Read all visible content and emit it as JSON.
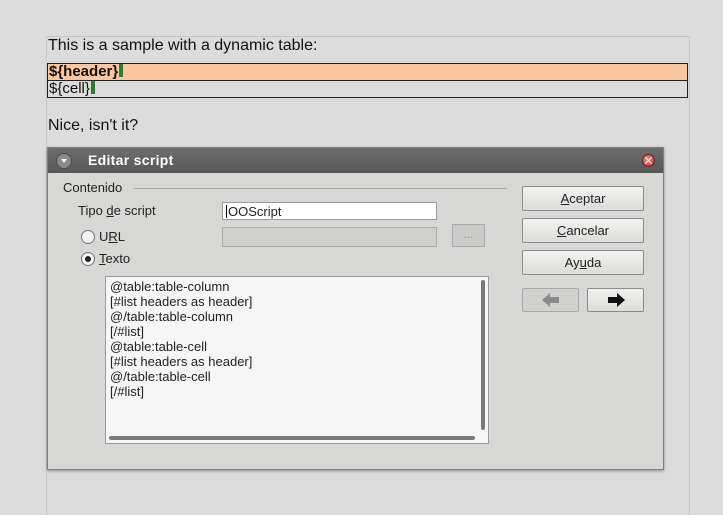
{
  "document": {
    "intro": "This is a sample with a dynamic table:",
    "table_rows": [
      "${header}",
      "${cell}"
    ],
    "outro": "Nice, isn't it?"
  },
  "dialog": {
    "title": "Editar script",
    "group_label": "Contenido",
    "script_type_label_pre": "Tipo ",
    "script_type_label_u": "d",
    "script_type_label_post": "e script",
    "script_type_value": "OOScript",
    "url_label_pre": "U",
    "url_label_u": "R",
    "url_label_post": "L",
    "url_selected": false,
    "text_label_pre": "",
    "text_label_u": "T",
    "text_label_post": "exto",
    "text_selected": true,
    "browse_label": "...",
    "code_lines": [
      "@table:table-column",
      "[#list headers as header]",
      "@/table:table-column",
      "[/#list]",
      "@table:table-cell",
      "[#list headers as header]",
      "@/table:table-cell",
      "[/#list]"
    ],
    "buttons": {
      "ok_u": "A",
      "ok_rest": "ceptar",
      "cancel_u": "C",
      "cancel_rest": "ancelar",
      "help_pre": "Ay",
      "help_u": "u",
      "help_post": "da"
    },
    "icons": {
      "menu": "chevron-down-icon",
      "close": "close-icon",
      "prev": "arrow-left-icon",
      "next": "arrow-right-icon"
    }
  }
}
